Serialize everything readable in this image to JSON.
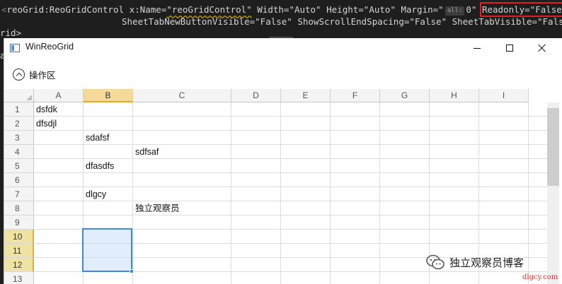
{
  "code": {
    "line1": {
      "open": "<",
      "tag": "reoGrid:ReoGridControl",
      "xname": " x:Name=",
      "name_value": "\"reoGridControl\"",
      "width": " Width=\"Auto\"",
      "height": " Height=\"Auto\"",
      "margin_attr": " Margin=\"",
      "margin_hint": "all:",
      "margin_tail": "0\" ",
      "readonly": "Readonly=\"False\""
    },
    "line2": "SheetTabNewButtonVisible=\"False\" ShowScrollEndSpacing=\"False\" SheetTabVisible=\"False\"/>",
    "line3": "rid>",
    "edge_char": "a"
  },
  "window": {
    "title": "WinReoGrid"
  },
  "expander": {
    "label": "操作区"
  },
  "grid": {
    "columns": [
      "A",
      "B",
      "C",
      "D",
      "E",
      "F",
      "G",
      "H",
      "I"
    ],
    "rows": [
      "1",
      "2",
      "3",
      "4",
      "5",
      "6",
      "7",
      "8",
      "9",
      "10",
      "11",
      "12",
      "13"
    ],
    "cells": {
      "A1": "dsfdk",
      "A2": "dfsdjl",
      "B3": "sdafsf",
      "C4": "sdfsaf",
      "B5": "dfasdfs",
      "B7": "dlgcy",
      "C8": "独立观察员"
    },
    "selected_column": "B",
    "selected_rows": [
      "10",
      "11",
      "12"
    ]
  },
  "watermark": {
    "text": "独立观察员博客",
    "url": "dlgcy.com"
  }
}
